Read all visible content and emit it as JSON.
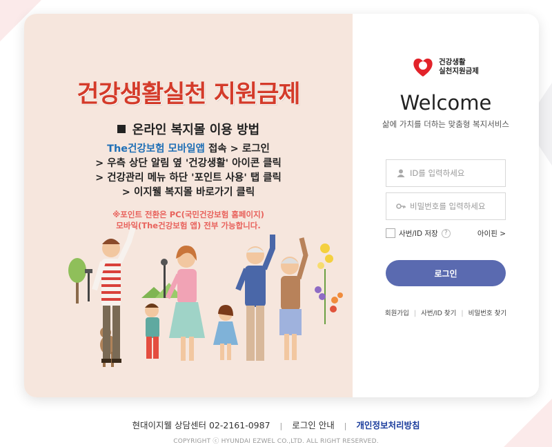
{
  "promo": {
    "title": "건강생활실천 지원금제",
    "subtitle": "온라인 복지몰 이용 방법",
    "step1_blue": "The건강보험 모바일앱",
    "step1_rest": " 접속 > 로그인",
    "step2": "> 우측 상단 알림 옆 '건강생활' 아이콘 클릭",
    "step3": "> 건강관리 메뉴 하단 '포인트 사용' 탭 클릭",
    "step4": "> 이지웰 복지몰 바로가기 클릭",
    "note_line1": "※포인트 전환은 PC(국민건강보험 홈페이지)",
    "note_line2": "모바일(The건강보험 앱) 전부 가능합니다."
  },
  "logo": {
    "line1": "건강생활",
    "line2": "실천지원금제",
    "color": "#e2232a"
  },
  "login": {
    "welcome": "Welcome",
    "tagline": "삶에 가치를 더하는 맞춤형 복지서비스",
    "id_placeholder": "ID를 입력하세요",
    "pw_placeholder": "비밀번호를 입력하세요",
    "save_label": "사번/ID 저장",
    "help_glyph": "?",
    "ipin_label": "아이핀 >",
    "button_label": "로그인",
    "button_color": "#5a6ab0"
  },
  "links": {
    "signup": "회원가입",
    "find_id": "사번/ID 찾기",
    "find_pw": "비밀번호 찾기"
  },
  "footer": {
    "center": "현대이지웰 상담센터 02-2161-0987",
    "login_guide": "로그인 안내",
    "privacy": "개인정보처리방침",
    "copyright": "COPYRIGHT ⓒ HYUNDAI EZWEL CO.,LTD. ALL RIGHT RESERVED."
  }
}
